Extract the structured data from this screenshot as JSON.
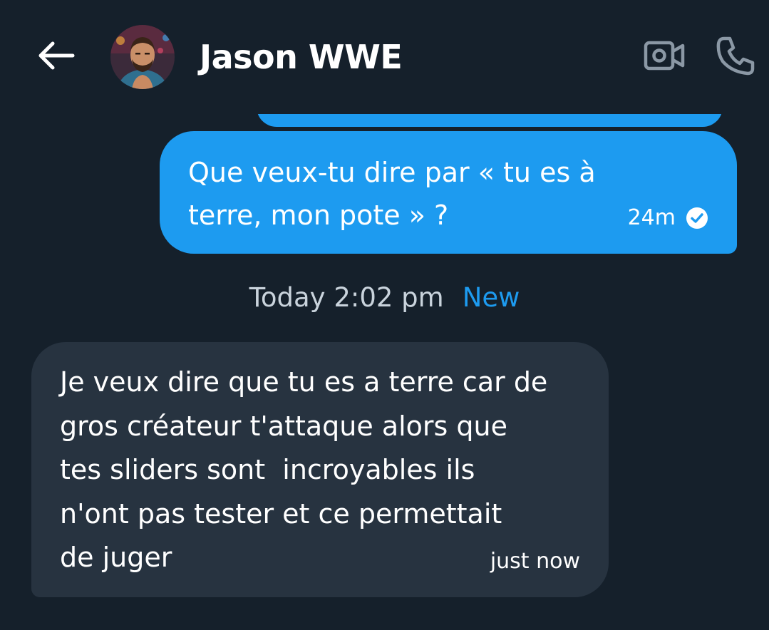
{
  "header": {
    "contact_name": "Jason WWE",
    "back_icon": "arrow-left-icon",
    "video_icon": "video-camera-icon",
    "call_icon": "phone-icon"
  },
  "messages": {
    "sent": {
      "text": "Que veux-tu dire par « tu es à terre, mon pote » ?",
      "time": "24m",
      "status_icon": "check-circle-icon"
    },
    "divider": {
      "date": "Today 2:02 pm",
      "new_label": "New"
    },
    "received": {
      "text": "Je veux dire que tu es a terre car de\ngros créateur t'attaque alors que\ntes sliders sont  incroyables ils\nn'ont pas tester et ce permettait\nde juger",
      "time": "just now"
    }
  },
  "colors": {
    "background": "#15202b",
    "accent": "#1d9bf0",
    "received_bubble": "#273340",
    "muted_text": "#c9d3dc",
    "icon_gray": "#8b98a5"
  }
}
